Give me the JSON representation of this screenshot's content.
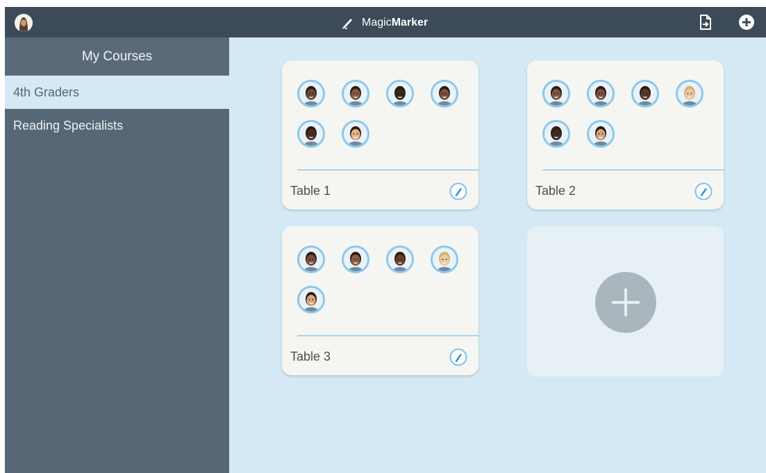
{
  "app": {
    "brand_light": "Magic",
    "brand_bold": "Marker"
  },
  "colors": {
    "topbar": "#3d4a58",
    "sidebar": "#586775",
    "content_bg": "#d4e9f3",
    "card_bg": "#f5f5f1",
    "accent": "#4ca8e0"
  },
  "topbar": {
    "avatar_icon": "user-avatar-icon",
    "export_icon": "export-document-icon",
    "add_icon": "add-circle-icon"
  },
  "sidebar": {
    "header": "My Courses",
    "items": [
      {
        "label": "4th Graders",
        "active": true
      },
      {
        "label": "Reading Specialists",
        "active": false
      }
    ]
  },
  "tables": [
    {
      "title": "Table 1",
      "students": [
        "#6b4a37",
        "#8a5a3f",
        "#3b2418",
        "#7a5140",
        "#4b2e20",
        "#e1b487"
      ]
    },
    {
      "title": "Table 2",
      "students": [
        "#7a5a45",
        "#7d5340",
        "#5a3a28",
        "#edc7a1",
        "#3f2a1f",
        "#d9a37a"
      ]
    },
    {
      "title": "Table 3",
      "students": [
        "#7c4f39",
        "#8b5e42",
        "#6a3f28",
        "#efcaa0",
        "#d9a47f"
      ]
    }
  ],
  "add_card": {
    "icon": "plus-icon"
  }
}
